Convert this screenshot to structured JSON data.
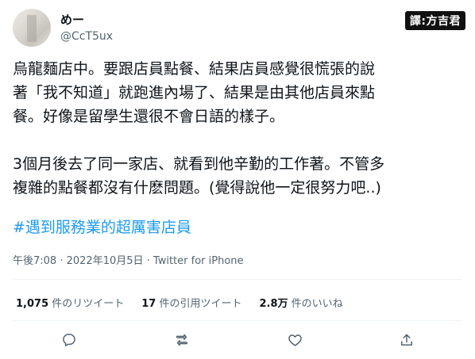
{
  "tweet": {
    "display_name": "めー",
    "handle": "@CcT5ux",
    "credit": "譯:方吉君",
    "lines": [
      "烏龍麵店中。要跟店員點餐、結果店員感覺很慌張的說",
      "著「我不知道」就跑進內場了、結果是由其他店員來點",
      "餐。好像是留學生還很不會日語的樣子。",
      "3個月後去了同一家店、就看到他辛勤的工作著。不管多",
      "複雜的點餐都沒有什麽問題。(覺得說他一定很努力吧..)"
    ],
    "hashtag": "#遇到服務業的超厲害店員",
    "time": "午後7:08",
    "separator": " · ",
    "date": "2022年10月5日",
    "source": "Twitter for iPhone"
  },
  "stats": {
    "retweets_count": "1,075",
    "retweets_label": " 件のリツイート",
    "quotes_count": "17",
    "quotes_label": " 件の引用ツイート",
    "likes_count": "2.8万",
    "likes_label": " 件のいいね"
  },
  "icons": {
    "reply": "reply-icon",
    "retweet": "retweet-icon",
    "like": "heart-icon",
    "share": "share-icon"
  },
  "colors": {
    "link": "#1d9bf0",
    "secondary_text": "#536471",
    "divider": "#eff3f4"
  }
}
